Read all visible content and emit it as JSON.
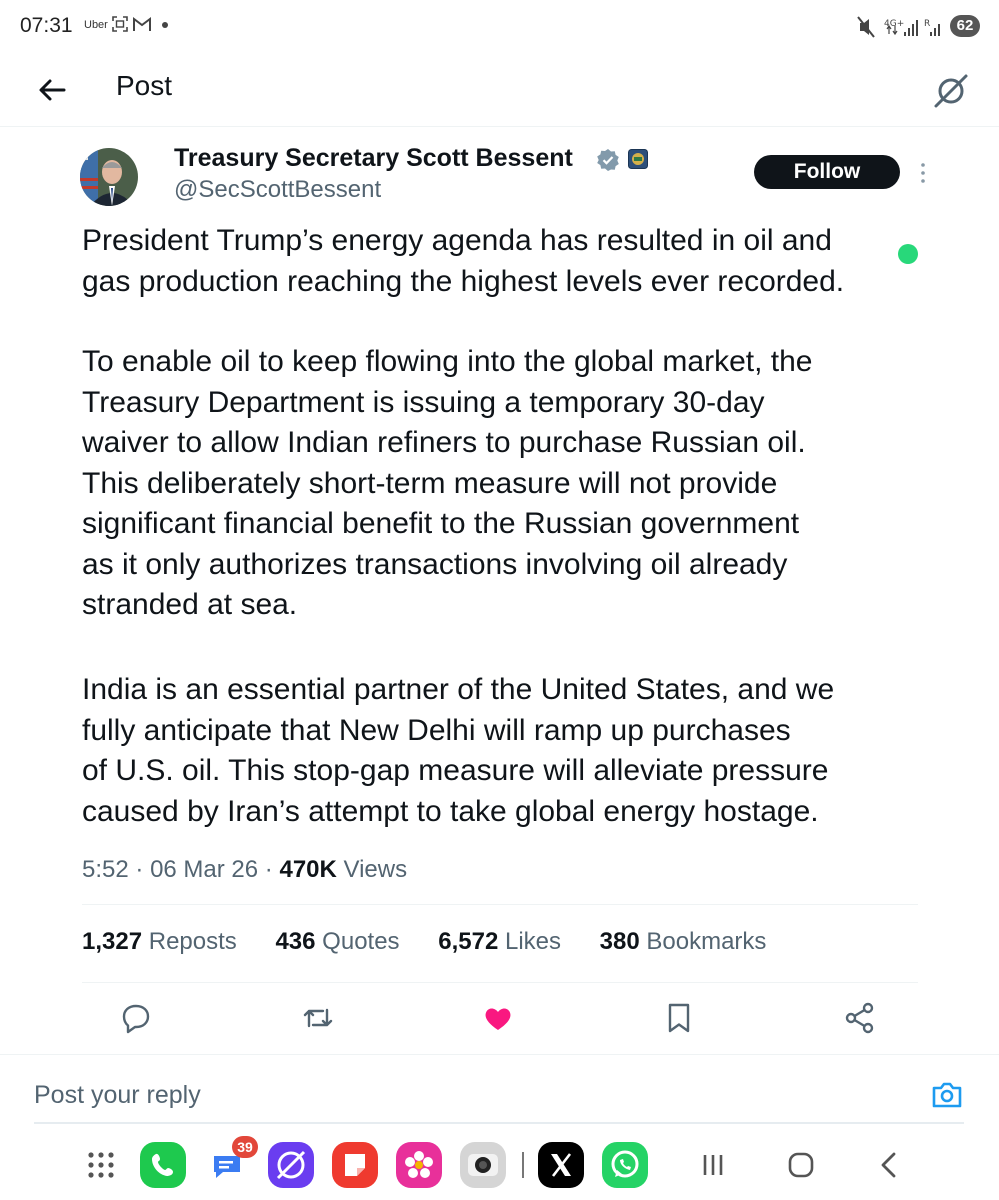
{
  "status_bar": {
    "time": "07:31",
    "notif_uber": "Uber",
    "battery": "62"
  },
  "header": {
    "title": "Post"
  },
  "post": {
    "author_name": "Treasury Secretary Scott Bessent",
    "handle": "@SecScottBessent",
    "follow_label": "Follow",
    "paragraphs": [
      "President Trump’s energy agenda has resulted in oil and\ngas production reaching the highest levels ever recorded.",
      "To enable oil to keep flowing into the global market, the\nTreasury Department is issuing a temporary 30-day\nwaiver to allow Indian refiners to purchase Russian oil.\nThis deliberately short-term measure will not provide\nsignificant financial benefit to the Russian government\nas it only authorizes transactions involving oil already\nstranded at sea.",
      "India is an essential partner of the United States, and we\nfully anticipate that New Delhi will ramp up purchases\nof U.S. oil. This stop-gap measure will alleviate pressure\ncaused by Iran’s attempt to take global energy hostage."
    ],
    "time": "5:52",
    "sep": "·",
    "date": "06 Mar 26",
    "views_count": "470K",
    "views_label": "Views"
  },
  "stats": {
    "reposts_count": "1,327",
    "reposts_label": "Reposts",
    "quotes_count": "436",
    "quotes_label": "Quotes",
    "likes_count": "6,572",
    "likes_label": "Likes",
    "bookmarks_count": "380",
    "bookmarks_label": "Bookmarks"
  },
  "actions": [
    "reply-icon",
    "repost-icon",
    "like-icon",
    "bookmark-icon",
    "share-icon"
  ],
  "colors": {
    "like": "#f91880",
    "icon_gray": "#536471",
    "accent": "#1d9bf0",
    "text": "#0f1419"
  },
  "reply": {
    "placeholder": "Post your reply"
  },
  "dock": {
    "messages_badge": "39",
    "apps": [
      "app-drawer-icon",
      "phone-app-icon",
      "messages-app-icon",
      "internet-app-icon",
      "notes-app-icon",
      "gallery-app-icon",
      "camera-app-icon",
      "x-app-icon",
      "whatsapp-app-icon"
    ]
  }
}
